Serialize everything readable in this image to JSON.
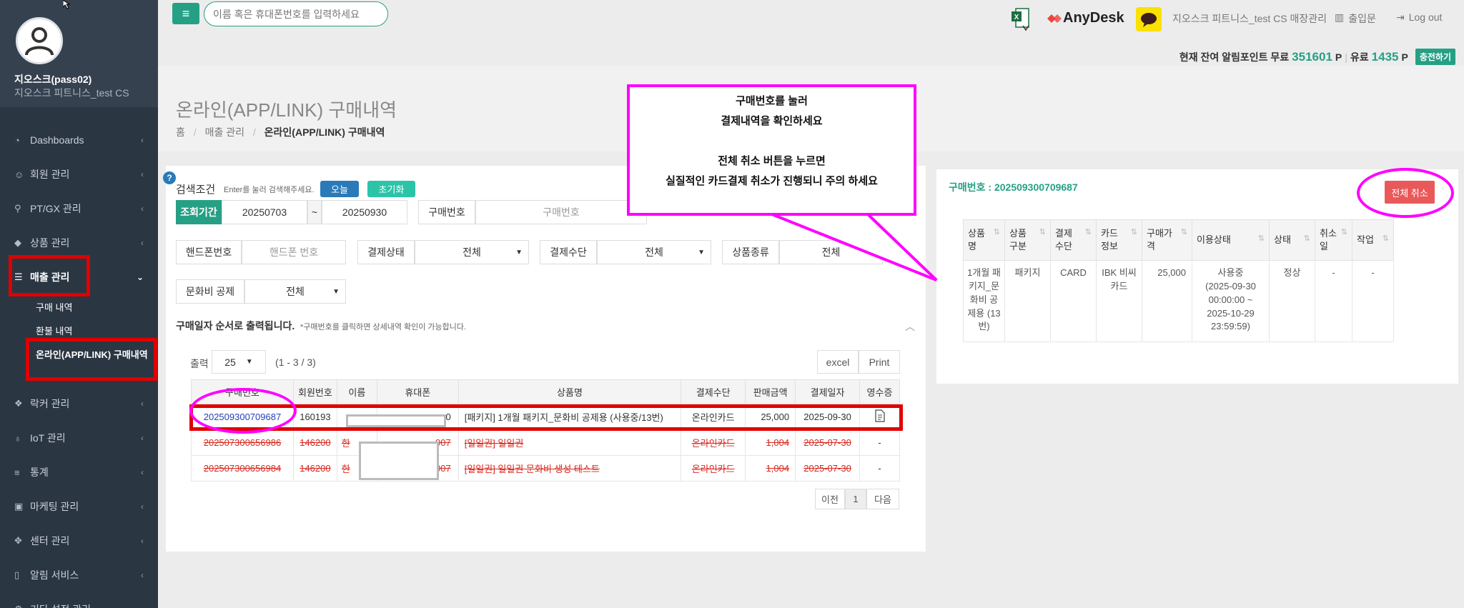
{
  "sidebar": {
    "user_name": "지오스크(pass02)",
    "user_sub": "지오스크 피트니스_test CS",
    "items": [
      {
        "label": "Dashboards",
        "icon": "dashboard-icon"
      },
      {
        "label": "회원 관리",
        "icon": "smile-icon"
      },
      {
        "label": "PT/GX 관리",
        "icon": "bicycle-icon"
      },
      {
        "label": "상품 관리",
        "icon": "tag-icon"
      },
      {
        "label": "매출 관리",
        "icon": "list-icon"
      },
      {
        "label": "락커 관리",
        "icon": "cubes-icon"
      },
      {
        "label": "IoT 관리",
        "icon": "bulb-icon"
      },
      {
        "label": "통계",
        "icon": "database-icon"
      },
      {
        "label": "마케팅 관리",
        "icon": "image-icon"
      },
      {
        "label": "센터 관리",
        "icon": "move-icon"
      },
      {
        "label": "알림 서비스",
        "icon": "phone-icon"
      },
      {
        "label": "기타 설정 관리",
        "icon": "settings-icon"
      }
    ],
    "sub_items": [
      "구매 내역",
      "환불 내역",
      "온라인(APP/LINK) 구매내역"
    ]
  },
  "topbar": {
    "search_placeholder": "이름 혹은 휴대폰번호를 입력하세요",
    "anydesk_label": "AnyDesk",
    "center_name": "지오스크 피트니스_test CS 매장관리",
    "checkin_label": "출입문",
    "logout_label": "Log out"
  },
  "points": {
    "prefix": "현재 잔여 알림포인트 무료",
    "free_value": "351601",
    "unit": "P",
    "separator": "|",
    "paid_prefix": "유료",
    "paid_value": "1435",
    "charge_label": "충전하기"
  },
  "page": {
    "title": "온라인(APP/LINK) 구매내역",
    "breadcrumb": [
      "홈",
      "매출 관리",
      "온라인(APP/LINK) 구매내역"
    ]
  },
  "search": {
    "cond_label": "검색조건",
    "hint": "Enter를 눌러 검색해주세요.",
    "today_label": "오늘",
    "reset_label": "초기화",
    "period_label": "조회기간",
    "date_from": "20250703",
    "tilde": "~",
    "date_to": "20250930",
    "order_no_label": "구매번호",
    "order_no_placeholder": "구매번호",
    "phone_label": "핸드폰번호",
    "phone_placeholder": "핸드폰 번호",
    "pay_status_label": "결제상태",
    "pay_status_value": "전체",
    "pay_method_label": "결제수단",
    "pay_method_value": "전체",
    "product_type_label": "상품종류",
    "product_type_value": "전체",
    "culture_label": "문화비 공제",
    "culture_value": "전체"
  },
  "list": {
    "section_title": "구매일자 순서로 출력됩니다.",
    "section_note": "*구매번호를 클릭하면 상세내역 확인이 가능합니다.",
    "output_label": "출력",
    "page_size": "25",
    "count_text": "(1 - 3 / 3)",
    "excel_label": "excel",
    "print_label": "Print",
    "columns": [
      "구매번호",
      "회원번호",
      "이름",
      "휴대폰",
      "상품명",
      "결제수단",
      "판매금액",
      "결제일자",
      "영수증"
    ],
    "rows": [
      {
        "order_no": "202509300709687",
        "member_no": "160193",
        "name": "",
        "phone": "0",
        "product": "[패키지] 1개월 패키지_문화비 공제용 (사용중/13번)",
        "method": "온라인카드",
        "amount": "25,000",
        "date": "2025-09-30",
        "receipt": ""
      },
      {
        "order_no": "202507300656986",
        "member_no": "146200",
        "name": "한",
        "phone": "007",
        "product": "[일일권] 일일권",
        "method": "온라인카드",
        "amount": "1,004",
        "date": "2025-07-30",
        "receipt": "-"
      },
      {
        "order_no": "202507300656984",
        "member_no": "146200",
        "name": "한",
        "phone": "007",
        "product": "[일일권] 일일권 문화비 생성 테스트",
        "method": "온라인카드",
        "amount": "1,004",
        "date": "2025-07-30",
        "receipt": "-"
      }
    ],
    "pager": {
      "prev": "이전",
      "page": "1",
      "next": "다음"
    }
  },
  "detail": {
    "order_no_label": "구매번호 : 202509300709687",
    "cancel_all_label": "전체 취소",
    "columns": [
      "상품\n명",
      "상품\n구분",
      "결제\n수단",
      "카드\n정보",
      "구매가\n격",
      "이용상태",
      "상태",
      "취소\n일",
      "작업"
    ],
    "row": [
      "1개월 패\n키지_문\n화비 공\n제용 (13\n번)",
      "패키지",
      "CARD",
      "IBK 비씨\n카드",
      "25,000",
      "사용중\n(2025-09-30\n00:00:00 ~\n2025-10-29\n23:59:59)",
      "정상",
      "-",
      "-"
    ]
  },
  "callout": {
    "line1": "구매번호를 눌러",
    "line2": "결제내역을 확인하세요",
    "line3": "전체 취소 버튼을 누르면",
    "line4": "실질적인 카드결제 취소가 진행되니 주의 하세요"
  },
  "colors": {
    "accent": "#26a085",
    "sidebar": "#2b3643",
    "annotation": "#ff00ff",
    "highlight": "#e00000"
  }
}
